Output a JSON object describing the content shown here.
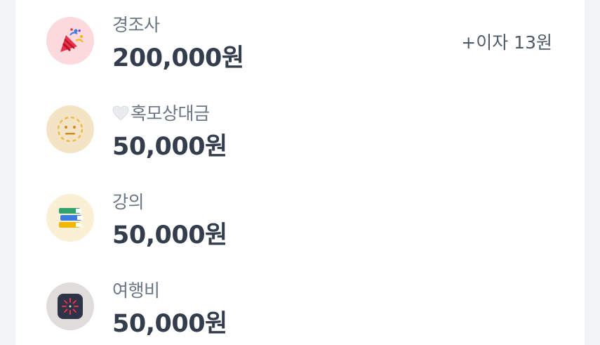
{
  "items": [
    {
      "icon": "party-popper-icon",
      "icon_bg": "#fcd9dc",
      "label": "경조사",
      "amount": "200,000원",
      "interest": "+이자 13원"
    },
    {
      "icon": "neutral-face-icon",
      "icon_bg": "#f4e4c6",
      "label_prefix_icon": "white-heart-icon",
      "label": "혹모상대금",
      "amount": "50,000원"
    },
    {
      "icon": "books-icon",
      "icon_bg": "#faf0d6",
      "label": "강의",
      "amount": "50,000원"
    },
    {
      "icon": "fireworks-icon",
      "icon_bg": "#e0dcdc",
      "label": "여행비",
      "amount": "50,000원"
    }
  ]
}
